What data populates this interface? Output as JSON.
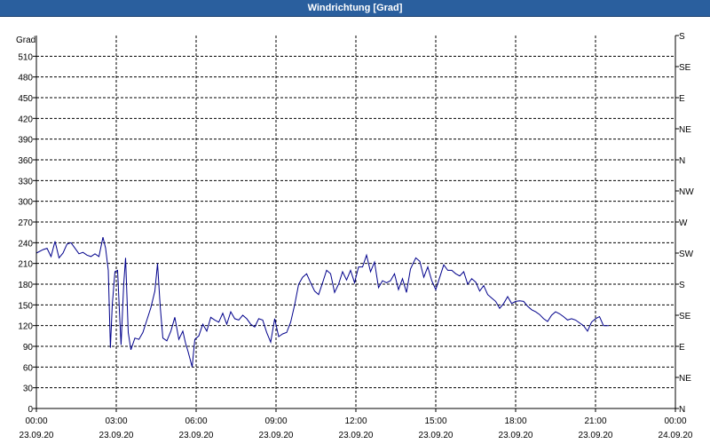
{
  "window": {
    "title": "Windrichtung [Grad]"
  },
  "colors": {
    "title_bg": "#2a5f9e",
    "series": "#00008b",
    "grid": "#000000"
  },
  "chart_data": {
    "type": "line",
    "title": "Windrichtung [Grad]",
    "ylabel": "Grad",
    "ylim": [
      0,
      540
    ],
    "y_ticks": [
      0,
      30,
      60,
      90,
      120,
      150,
      180,
      210,
      240,
      270,
      300,
      330,
      360,
      390,
      420,
      450,
      480,
      510
    ],
    "right_axis_labels": [
      "N",
      "NE",
      "E",
      "SE",
      "S",
      "SW",
      "W",
      "NW",
      "N",
      "NE",
      "E",
      "SE",
      "S"
    ],
    "x_tick_labels": [
      {
        "time": "00:00",
        "date": "23.09.20"
      },
      {
        "time": "03:00",
        "date": "23.09.20"
      },
      {
        "time": "06:00",
        "date": "23.09.20"
      },
      {
        "time": "09:00",
        "date": "23.09.20"
      },
      {
        "time": "12:00",
        "date": "23.09.20"
      },
      {
        "time": "15:00",
        "date": "23.09.20"
      },
      {
        "time": "18:00",
        "date": "23.09.20"
      },
      {
        "time": "21:00",
        "date": "23.09.20"
      },
      {
        "time": "00:00",
        "date": "24.09.20"
      }
    ],
    "x_unit": "hours since 23.09.20 00:00",
    "xlim": [
      0,
      24
    ],
    "grid": true,
    "series": [
      {
        "color": "#00008b",
        "points": [
          [
            0,
            225
          ],
          [
            0.25,
            230
          ],
          [
            0.4,
            232
          ],
          [
            0.55,
            220
          ],
          [
            0.7,
            242
          ],
          [
            0.85,
            218
          ],
          [
            1.0,
            225
          ],
          [
            1.15,
            238
          ],
          [
            1.3,
            240
          ],
          [
            1.45,
            232
          ],
          [
            1.6,
            224
          ],
          [
            1.75,
            226
          ],
          [
            1.9,
            222
          ],
          [
            2.05,
            220
          ],
          [
            2.2,
            224
          ],
          [
            2.35,
            220
          ],
          [
            2.5,
            248
          ],
          [
            2.6,
            232
          ],
          [
            2.7,
            200
          ],
          [
            2.78,
            88
          ],
          [
            2.85,
            150
          ],
          [
            2.95,
            198
          ],
          [
            3.05,
            200
          ],
          [
            3.12,
            140
          ],
          [
            3.18,
            92
          ],
          [
            3.28,
            180
          ],
          [
            3.35,
            218
          ],
          [
            3.45,
            110
          ],
          [
            3.55,
            85
          ],
          [
            3.7,
            102
          ],
          [
            3.85,
            100
          ],
          [
            4.0,
            110
          ],
          [
            4.15,
            128
          ],
          [
            4.3,
            146
          ],
          [
            4.45,
            170
          ],
          [
            4.55,
            210
          ],
          [
            4.65,
            148
          ],
          [
            4.75,
            102
          ],
          [
            4.9,
            98
          ],
          [
            5.05,
            112
          ],
          [
            5.2,
            132
          ],
          [
            5.35,
            100
          ],
          [
            5.5,
            112
          ],
          [
            5.6,
            95
          ],
          [
            5.7,
            82
          ],
          [
            5.85,
            60
          ],
          [
            5.95,
            100
          ],
          [
            6.1,
            105
          ],
          [
            6.25,
            122
          ],
          [
            6.4,
            112
          ],
          [
            6.55,
            132
          ],
          [
            6.7,
            128
          ],
          [
            6.85,
            125
          ],
          [
            7.0,
            138
          ],
          [
            7.15,
            122
          ],
          [
            7.3,
            140
          ],
          [
            7.45,
            130
          ],
          [
            7.6,
            128
          ],
          [
            7.75,
            135
          ],
          [
            7.9,
            130
          ],
          [
            8.05,
            122
          ],
          [
            8.2,
            118
          ],
          [
            8.35,
            130
          ],
          [
            8.5,
            128
          ],
          [
            8.65,
            110
          ],
          [
            8.8,
            96
          ],
          [
            8.95,
            130
          ],
          [
            9.1,
            104
          ],
          [
            9.25,
            108
          ],
          [
            9.4,
            110
          ],
          [
            9.55,
            125
          ],
          [
            9.7,
            150
          ],
          [
            9.85,
            180
          ],
          [
            10.0,
            190
          ],
          [
            10.15,
            195
          ],
          [
            10.3,
            182
          ],
          [
            10.45,
            170
          ],
          [
            10.6,
            165
          ],
          [
            10.75,
            182
          ],
          [
            10.9,
            200
          ],
          [
            11.05,
            195
          ],
          [
            11.2,
            168
          ],
          [
            11.35,
            180
          ],
          [
            11.5,
            198
          ],
          [
            11.65,
            186
          ],
          [
            11.8,
            200
          ],
          [
            11.95,
            182
          ],
          [
            12.1,
            205
          ],
          [
            12.25,
            205
          ],
          [
            12.4,
            222
          ],
          [
            12.55,
            198
          ],
          [
            12.7,
            212
          ],
          [
            12.85,
            175
          ],
          [
            13.0,
            185
          ],
          [
            13.15,
            182
          ],
          [
            13.3,
            185
          ],
          [
            13.45,
            195
          ],
          [
            13.6,
            172
          ],
          [
            13.75,
            188
          ],
          [
            13.9,
            168
          ],
          [
            14.05,
            202
          ],
          [
            14.25,
            218
          ],
          [
            14.4,
            213
          ],
          [
            14.55,
            190
          ],
          [
            14.7,
            205
          ],
          [
            14.85,
            185
          ],
          [
            15.0,
            172
          ],
          [
            15.15,
            190
          ],
          [
            15.3,
            208
          ],
          [
            15.45,
            200
          ],
          [
            15.6,
            200
          ],
          [
            15.75,
            195
          ],
          [
            15.9,
            192
          ],
          [
            16.05,
            198
          ],
          [
            16.2,
            180
          ],
          [
            16.35,
            188
          ],
          [
            16.5,
            183
          ],
          [
            16.65,
            170
          ],
          [
            16.8,
            178
          ],
          [
            16.95,
            165
          ],
          [
            17.1,
            160
          ],
          [
            17.25,
            155
          ],
          [
            17.4,
            145
          ],
          [
            17.55,
            152
          ],
          [
            17.7,
            162
          ],
          [
            17.85,
            152
          ],
          [
            18.0,
            155
          ],
          [
            18.15,
            156
          ],
          [
            18.3,
            155
          ],
          [
            18.45,
            148
          ],
          [
            18.6,
            143
          ],
          [
            18.75,
            140
          ],
          [
            18.9,
            136
          ],
          [
            19.05,
            130
          ],
          [
            19.2,
            126
          ],
          [
            19.35,
            135
          ],
          [
            19.5,
            140
          ],
          [
            19.65,
            137
          ],
          [
            19.8,
            133
          ],
          [
            19.95,
            128
          ],
          [
            20.1,
            130
          ],
          [
            20.25,
            128
          ],
          [
            20.4,
            124
          ],
          [
            20.55,
            120
          ],
          [
            20.7,
            112
          ],
          [
            20.85,
            125
          ],
          [
            21.0,
            130
          ],
          [
            21.15,
            133
          ],
          [
            21.3,
            120
          ],
          [
            21.5,
            120
          ]
        ]
      }
    ]
  }
}
